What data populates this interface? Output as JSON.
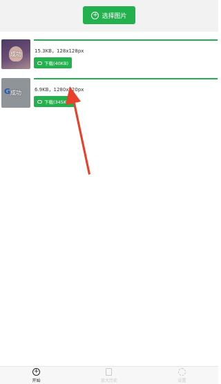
{
  "header": {
    "select_label": "选择图片"
  },
  "items": [
    {
      "status": "成功",
      "info": "15.3KB，128x128px",
      "download_label": "下载(40KB)",
      "progress": 1.0
    },
    {
      "status": "成功",
      "info": "6.9KB，1280x720px",
      "download_label": "下载(345KB)",
      "progress": 1.0
    }
  ],
  "tabs": [
    {
      "label": "开始",
      "icon": "plus-circle-icon",
      "active": true
    },
    {
      "label": "放大历史",
      "icon": "document-icon",
      "active": false
    },
    {
      "label": "设置",
      "icon": "gear-icon",
      "active": false
    }
  ],
  "colors": {
    "accent": "#22b14c",
    "annotation": "#e8402a"
  }
}
